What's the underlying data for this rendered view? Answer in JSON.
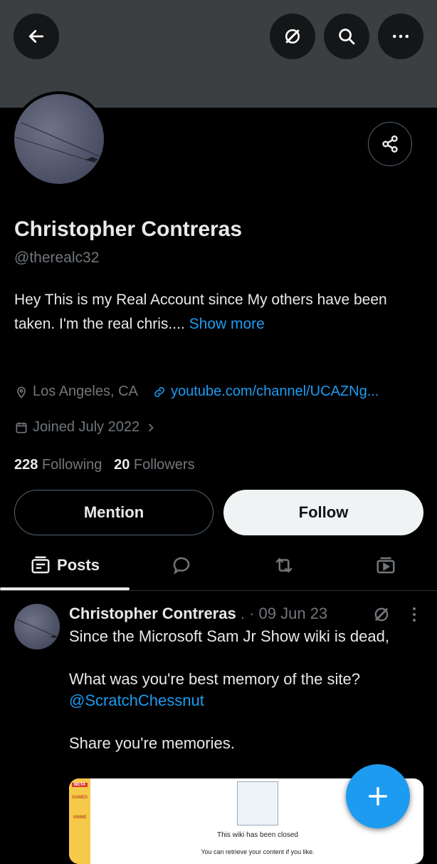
{
  "header": {
    "back_icon": "arrow-left-icon",
    "grok_icon": "grok-icon",
    "search_icon": "search-icon",
    "more_icon": "more-horizontal-icon"
  },
  "profile": {
    "name": "Christopher Contreras",
    "handle": "@therealc32",
    "bio": "Hey This is my Real Account since My others have been taken. I'm the real chris....",
    "show_more": "Show more",
    "location": "Los Angeles, CA",
    "website": "youtube.com/channel/UCAZNg...",
    "joined": "Joined July 2022",
    "following_count": "228",
    "following_label": "Following",
    "followers_count": "20",
    "followers_label": "Followers"
  },
  "actions": {
    "mention_label": "Mention",
    "follow_label": "Follow"
  },
  "tabs": {
    "posts_label": "Posts",
    "icons": [
      "posts-icon",
      "replies-icon",
      "reposts-icon",
      "media-icon"
    ]
  },
  "post": {
    "author": "Christopher Contreras",
    "sep": ". ·",
    "date": "09 Jun 23",
    "line1": "Since the Microsoft Sam Jr Show wiki is dead,",
    "line2": "What was you're best memory of the site?",
    "mention": "@ScratchChessnut",
    "line3": "Share you're memories.",
    "media_title": "This wiki has been closed",
    "media_sub": "You can retrieve your content if you like.",
    "media_side_labels": [
      "BETA",
      "GAMES",
      "ANIME"
    ]
  },
  "colors": {
    "accent": "#1d9bf0",
    "banner": "#3b3f42",
    "background": "#000000",
    "muted": "#71767b"
  }
}
